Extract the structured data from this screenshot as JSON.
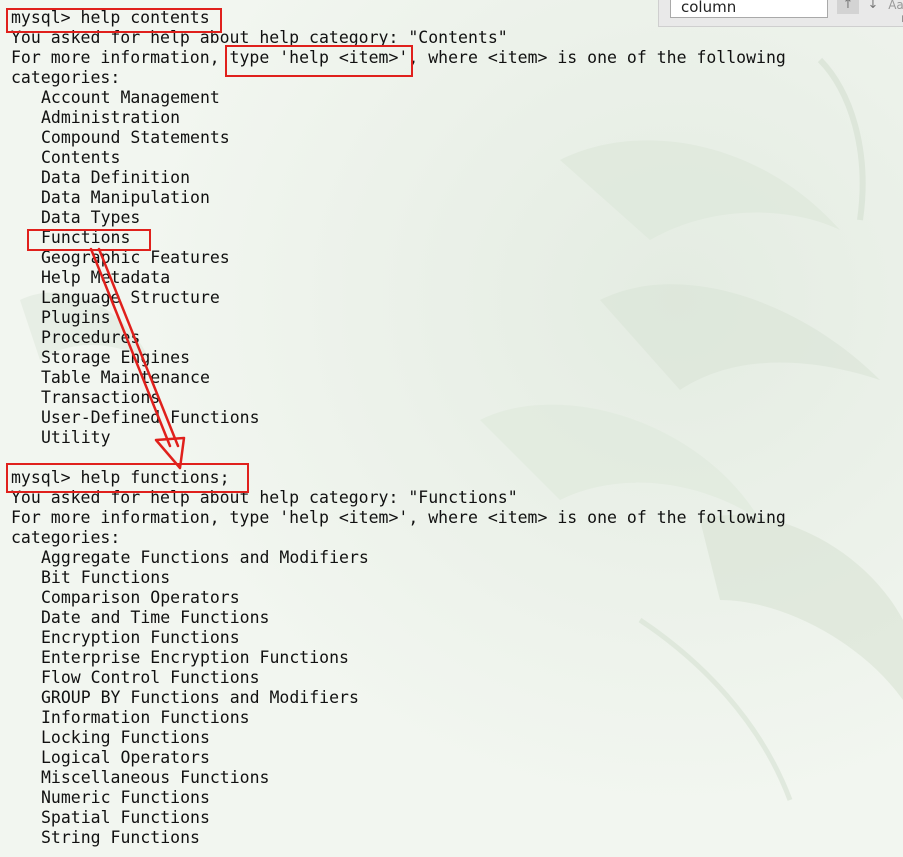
{
  "find_bar": {
    "query": "column",
    "prev_label": "↑",
    "next_label": "↓",
    "case_label": "Aa",
    "expand_label": "▶"
  },
  "session1": {
    "prompt": "mysql> help contents",
    "line1": "You asked for help about help category: \"Contents\"",
    "line2_before": "For more information, ",
    "line2_highlight": "type 'help <item>'",
    "line2_after": ", where <item> is one of the following",
    "line3": "categories:",
    "items": [
      "Account Management",
      "Administration",
      "Compound Statements",
      "Contents",
      "Data Definition",
      "Data Manipulation",
      "Data Types",
      "Functions",
      "Geographic Features",
      "Help Metadata",
      "Language Structure",
      "Plugins",
      "Procedures",
      "Storage Engines",
      "Table Maintenance",
      "Transactions",
      "User-Defined Functions",
      "Utility"
    ]
  },
  "session2": {
    "prompt": "mysql> help functions;",
    "line1": "You asked for help about help category: \"Functions\"",
    "line2": "For more information, type 'help <item>', where <item> is one of the following",
    "line3": "categories:",
    "items": [
      "Aggregate Functions and Modifiers",
      "Bit Functions",
      "Comparison Operators",
      "Date and Time Functions",
      "Encryption Functions",
      "Enterprise Encryption Functions",
      "Flow Control Functions",
      "GROUP BY Functions and Modifiers",
      "Information Functions",
      "Locking Functions",
      "Logical Operators",
      "Miscellaneous Functions",
      "Numeric Functions",
      "Spatial Functions",
      "String Functions"
    ]
  },
  "colors": {
    "annotation": "#e0201c",
    "background": "#eef3ec",
    "text": "#111111"
  }
}
